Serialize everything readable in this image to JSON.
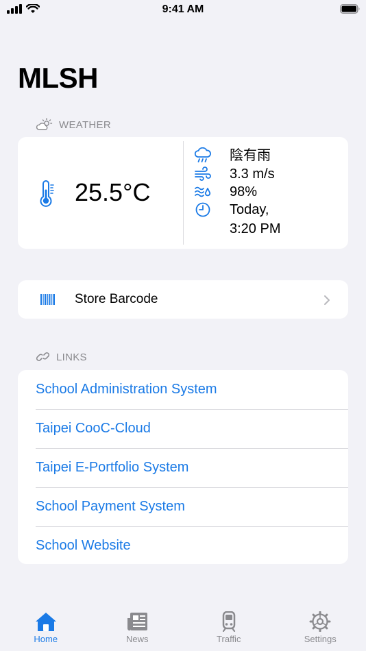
{
  "status_bar": {
    "time": "9:41 AM"
  },
  "page": {
    "title": "MLSH"
  },
  "weather": {
    "section_title": "WEATHER",
    "temperature": "25.5°C",
    "condition": "陰有雨",
    "wind": "3.3 m/s",
    "humidity": "98%",
    "updated_line1": "Today,",
    "updated_line2": "3:20 PM"
  },
  "barcode": {
    "label": "Store Barcode"
  },
  "links": {
    "section_title": "LINKS",
    "items": [
      {
        "label": "School Administration System"
      },
      {
        "label": "Taipei CooC-Cloud"
      },
      {
        "label": "Taipei E-Portfolio System"
      },
      {
        "label": "School Payment System"
      },
      {
        "label": "School Website"
      }
    ]
  },
  "tab_bar": {
    "tabs": [
      {
        "label": "Home",
        "icon": "house-icon",
        "active": true
      },
      {
        "label": "News",
        "icon": "newspaper-icon",
        "active": false
      },
      {
        "label": "Traffic",
        "icon": "tram-icon",
        "active": false
      },
      {
        "label": "Settings",
        "icon": "gear-icon",
        "active": false
      }
    ]
  },
  "colors": {
    "accent": "#1a7ae6",
    "background": "#f2f2f7",
    "secondary_text": "#8a8a8e"
  }
}
